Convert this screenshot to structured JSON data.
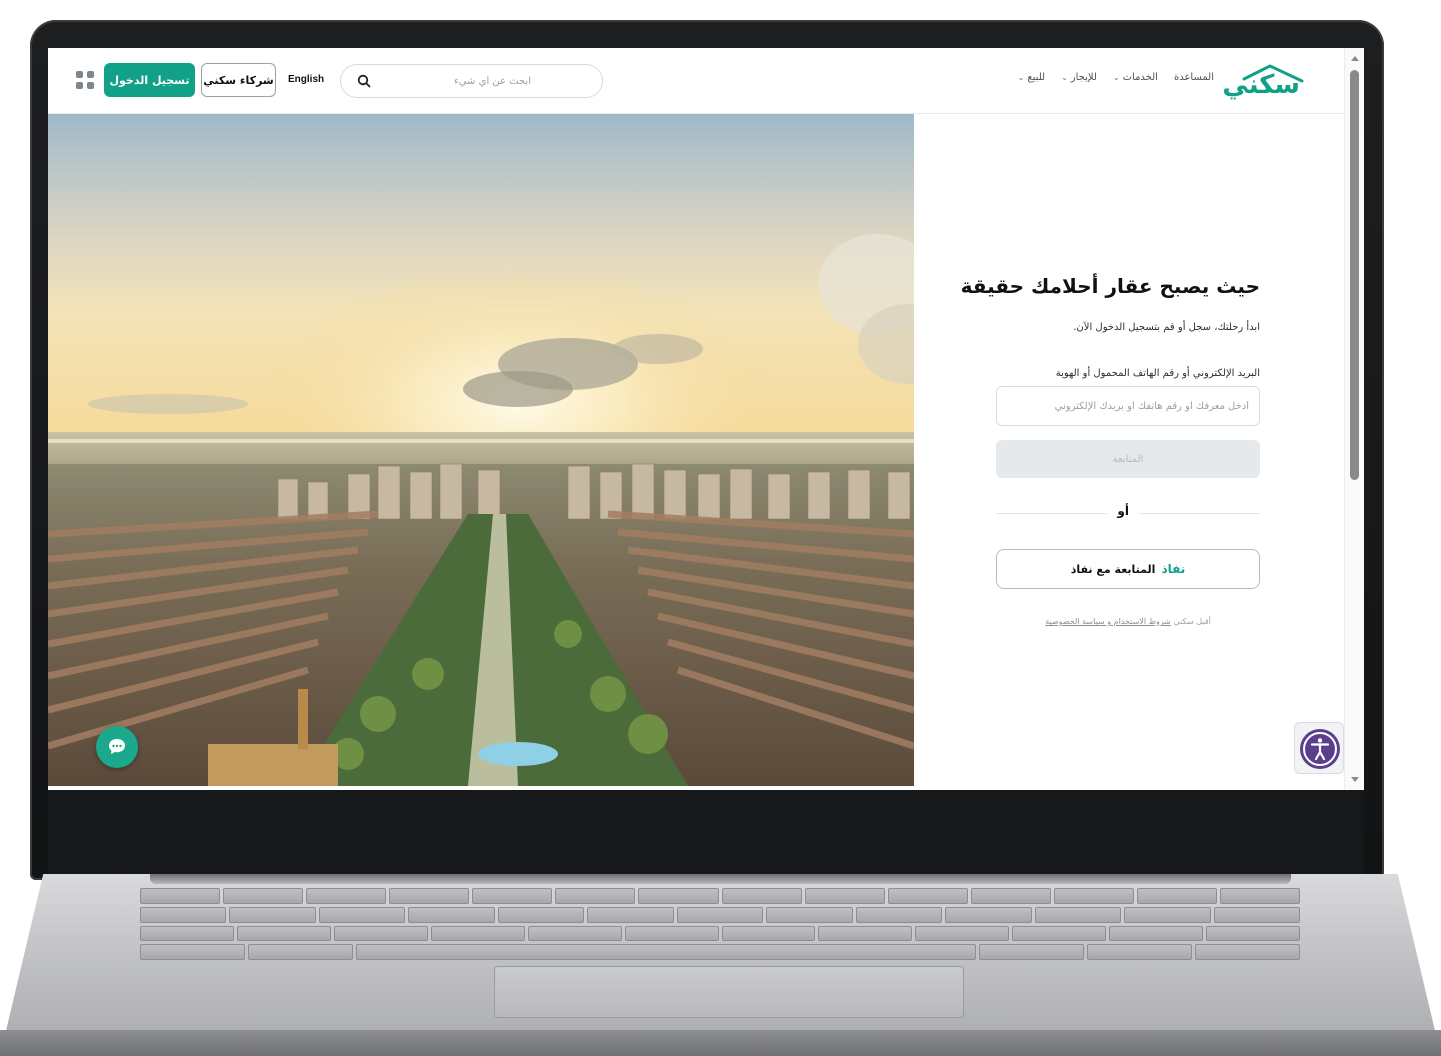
{
  "header": {
    "logo_text": "سكني",
    "nav": [
      {
        "label": "للبيع",
        "has_dropdown": true
      },
      {
        "label": "للإيجار",
        "has_dropdown": true
      },
      {
        "label": "الخدمات",
        "has_dropdown": true
      },
      {
        "label": "المساعدة",
        "has_dropdown": false
      }
    ],
    "search_placeholder": "ابحث عن أي شيء",
    "language_link": "English",
    "partners_button": "شركاء سكني",
    "login_button": "تسجيل الدخول"
  },
  "login": {
    "title": "حيث يصبح عقار أحلامك حقيقة",
    "subtitle": "ابدأ رحلتك، سجل أو قم بتسجيل الدخول الآن.",
    "field_label": "البريد الإلكتروني أو رقم الهاتف المحمول أو الهوية",
    "field_placeholder": "أدخل معرفك أو رقم هاتفك أو بريدك الإلكتروني",
    "continue_button": "المتابعة",
    "or_text": "أو",
    "nafath_logo_text": "نفاذ",
    "nafath_button": "المتابعة مع نفاذ",
    "terms_prefix": "أقبل سكني",
    "terms_link": "شروط الاستخدام و سياسة الخصوصية"
  },
  "colors": {
    "brand": "#11a088",
    "button_disabled": "#e6e9ec"
  },
  "icons": {
    "search": "search-icon",
    "apps": "apps-grid-icon",
    "chat": "chat-icon",
    "accessibility": "accessibility-icon",
    "chevron": "chevron-down-icon"
  }
}
